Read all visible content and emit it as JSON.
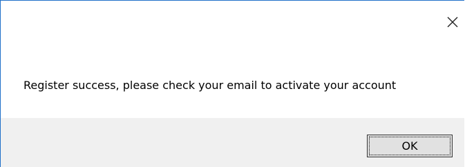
{
  "dialog": {
    "message": "Register success, please check your email to activate your account",
    "ok_label": "OK",
    "close_icon": "close-icon",
    "border_color": "#1f6fc9",
    "footer_color": "#f0f0f0"
  }
}
